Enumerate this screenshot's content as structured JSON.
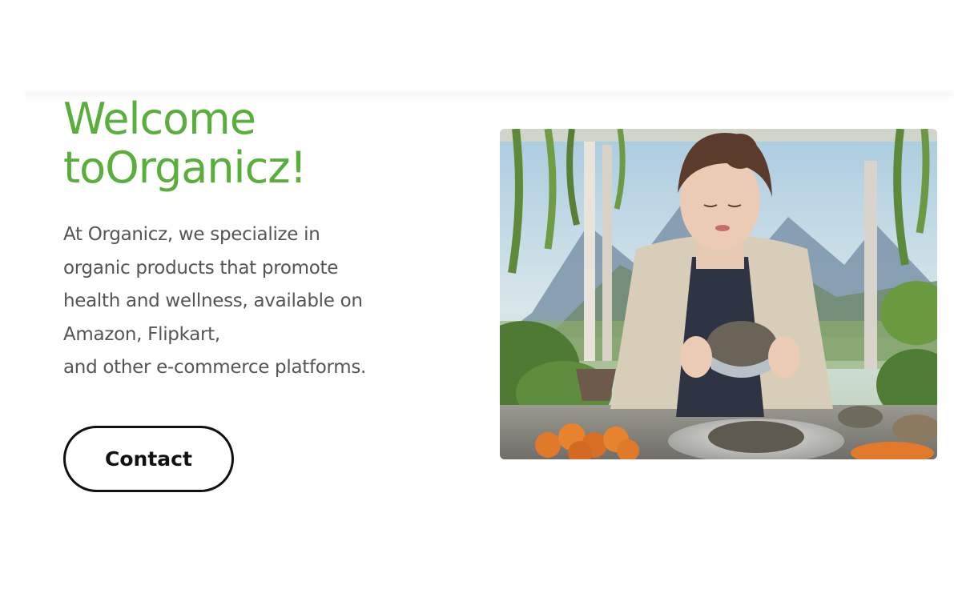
{
  "hero": {
    "title_line1": "Welcome",
    "title_line2": "toOrganicz!",
    "description_lines": [
      "At Organicz, we specialize in",
      "organic products that promote",
      "health and wellness, available on",
      "Amazon, Flipkart,",
      "and other e-commerce platforms."
    ],
    "contact_label": "Contact",
    "image_alt": "Woman holding a bowl of seeds in a greenhouse kitchen"
  },
  "colors": {
    "accent_green": "#5aae3c",
    "body_text": "#555555",
    "button_border": "#111111"
  }
}
